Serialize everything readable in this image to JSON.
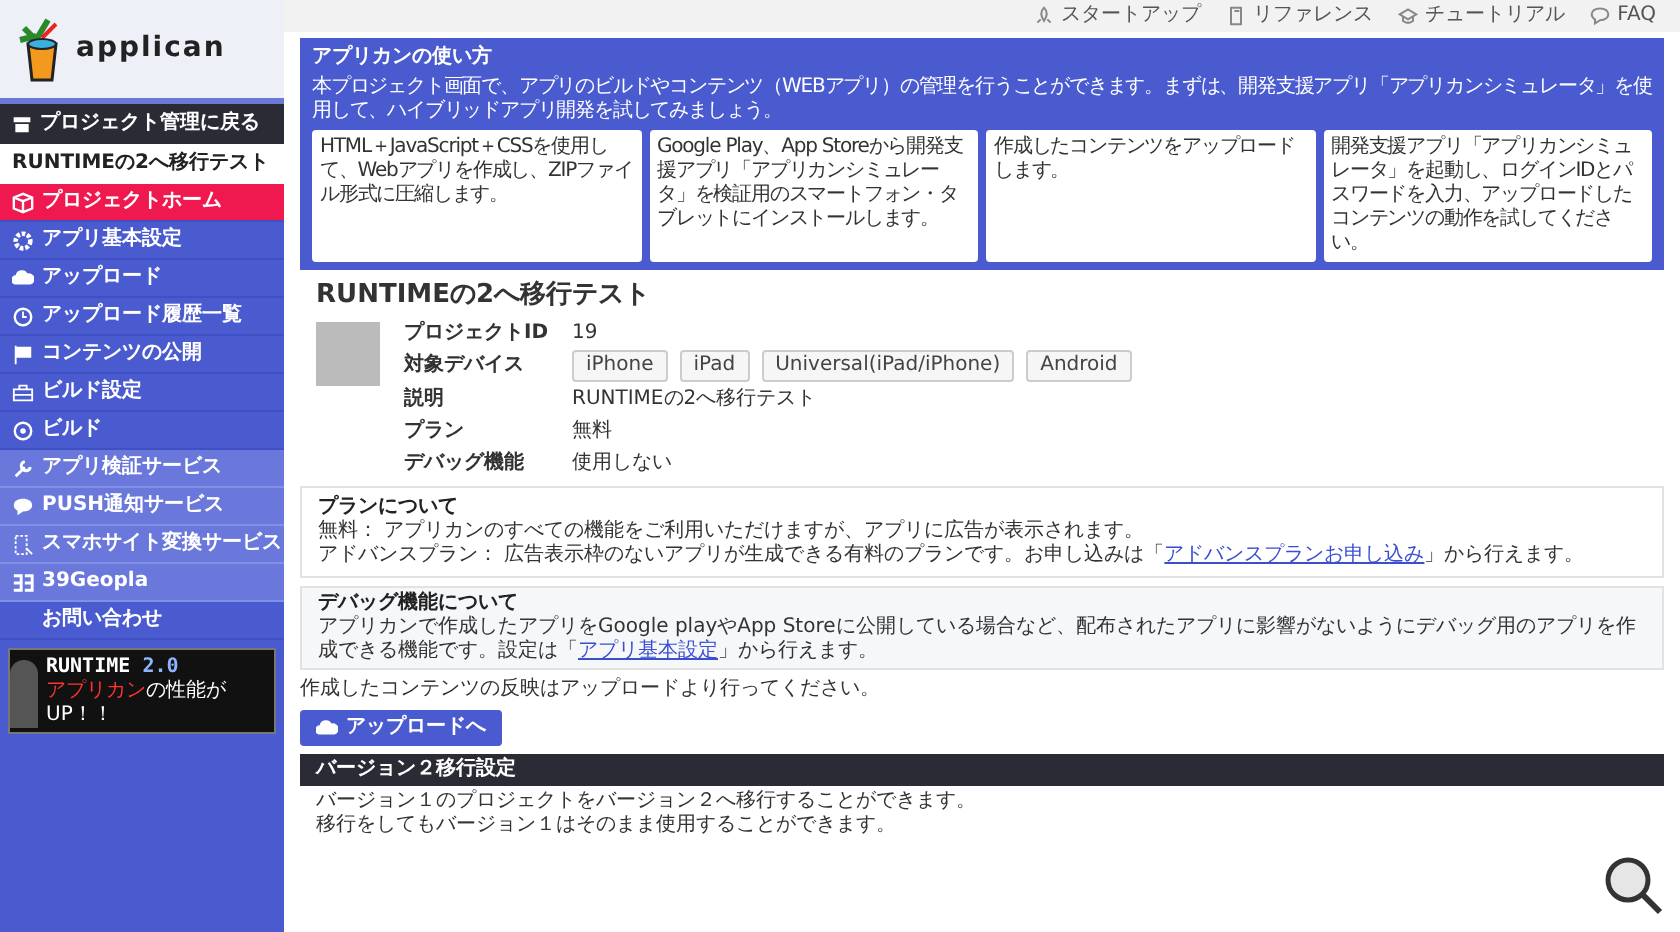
{
  "logo": {
    "text": "applican"
  },
  "sidebar": {
    "back": "プロジェクト管理に戻る",
    "project_name": "RUNTIMEの2へ移行テスト",
    "items": [
      {
        "label": "プロジェクトホーム",
        "kind": "main",
        "selected": true
      },
      {
        "label": "アプリ基本設定",
        "kind": "main",
        "selected": false
      },
      {
        "label": "アップロード",
        "kind": "main",
        "selected": false
      },
      {
        "label": "アップロード履歴一覧",
        "kind": "main",
        "selected": false
      },
      {
        "label": "コンテンツの公開",
        "kind": "main",
        "selected": false
      },
      {
        "label": "ビルド設定",
        "kind": "main",
        "selected": false
      },
      {
        "label": "ビルド",
        "kind": "main",
        "selected": false
      },
      {
        "label": "アプリ検証サービス",
        "kind": "service",
        "selected": false
      },
      {
        "label": "PUSH通知サービス",
        "kind": "service",
        "selected": false
      },
      {
        "label": "スマホサイト変換サービス",
        "kind": "service",
        "selected": false
      },
      {
        "label": "39Geopla",
        "kind": "service",
        "selected": false
      },
      {
        "label": "お問い合わせ",
        "kind": "main",
        "selected": false
      }
    ],
    "banner": {
      "title": "RUNTIME",
      "version": "2.0",
      "tagline_highlight": "アプリカン",
      "tagline": "の性能が UP！！"
    }
  },
  "top_links": [
    {
      "label": "スタートアップ"
    },
    {
      "label": "リファレンス"
    },
    {
      "label": "チュートリアル"
    },
    {
      "label": "FAQ"
    }
  ],
  "howto": {
    "title": "アプリカンの使い方",
    "intro": "本プロジェクト画面で、アプリのビルドやコンテンツ（WEBアプリ）の管理を行うことができます。まずは、開発支援アプリ「アプリカンシミュレータ」を使用して、ハイブリッドアプリ開発を試してみましょう。",
    "steps": [
      "HTML＋JavaScript＋CSSを使用して、Webアプリを作成し、ZIPファイル形式に圧縮します。",
      "Google Play、App Storeから開発支援アプリ「アプリカンシミュレータ」を検証用のスマートフォン・タブレットにインストールします。",
      "作成したコンテンツをアップロードします。",
      "開発支援アプリ「アプリカンシミュレータ」を起動し、ログインIDとパスワードを入力、アップロードしたコンテンツの動作を試してください。"
    ]
  },
  "project": {
    "title": "RUNTIMEの2へ移行テスト",
    "fields": [
      {
        "label": "プロジェクトID",
        "kind": "text",
        "value": "19"
      },
      {
        "label": "対象デバイス",
        "kind": "tags",
        "tags": [
          "iPhone",
          "iPad",
          "Universal(iPad/iPhone)",
          "Android"
        ]
      },
      {
        "label": "説明",
        "kind": "text",
        "value": "RUNTIMEの2へ移行テスト"
      },
      {
        "label": "プラン",
        "kind": "text",
        "value": "無料"
      },
      {
        "label": "デバッグ機能",
        "kind": "text",
        "value": "使用しない"
      }
    ]
  },
  "plan_note": {
    "title": "プランについて",
    "line_1": "無料： アプリカンのすべての機能をご利用いただけますが、アプリに広告が表示されます。",
    "line_2_before": "アドバンスプラン： 広告表示枠のないアプリが生成できる有料のプランです。お申し込みは「",
    "line_2_link": "アドバンスプランお申し込み",
    "line_2_after": "」から行えます。"
  },
  "debug_note": {
    "title": "デバッグ機能について",
    "before": "アプリカンで作成したアプリをGoogle playやApp Storeに公開している場合など、配布されたアプリに影響がないようにデバッグ用のアプリを作成できる機能です。設定は「",
    "link": "アプリ基本設定",
    "after": "」から行えます。"
  },
  "upload": {
    "note": "作成したコンテンツの反映はアップロードより行ってください。",
    "button": "アップロードへ"
  },
  "migration": {
    "title": "バージョン２移行設定",
    "lines": [
      "バージョン１のプロジェクトをバージョン２へ移行することができます。",
      "移行をしてもバージョン１はそのまま使用することができます。"
    ]
  }
}
